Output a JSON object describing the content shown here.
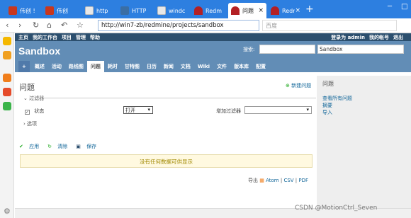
{
  "browser": {
    "tabs": [
      {
        "label": "伟创 !",
        "color": "#c8371e"
      },
      {
        "label": "伟创",
        "color": "#c8371e"
      },
      {
        "label": "http",
        "color": "#e8e8e8"
      },
      {
        "label": "HTTP",
        "color": "#3a6ea5"
      },
      {
        "label": "windc",
        "color": "#e8e8e8"
      },
      {
        "label": "Redm",
        "color": "#b32024"
      },
      {
        "label": "问题",
        "color": "#b32024"
      },
      {
        "label": "Redm",
        "color": "#b32024"
      }
    ],
    "new_tab": "+",
    "url": "http://win7-zb/redmine/projects/sandbox",
    "search_placeholder": "百度"
  },
  "redmine": {
    "top_menu": [
      "主页",
      "我的工作台",
      "项目",
      "管理",
      "帮助"
    ],
    "logged_in_as": "登录为 admin",
    "my_account": "我的帐号",
    "logout": "退出",
    "project_title": "Sandbox",
    "search_label": "搜索:",
    "project_jump": "Sandbox",
    "main_menu": [
      "+",
      "概述",
      "活动",
      "路线图",
      "问题",
      "耗时",
      "甘特图",
      "日历",
      "新闻",
      "文档",
      "Wiki",
      "文件",
      "版本库",
      "配置"
    ],
    "active_menu": "问题"
  },
  "content": {
    "title": "问题",
    "new_issue": "新建问题",
    "filters_label": "过滤器",
    "status_label": "状态",
    "status_operator": "打开",
    "add_filter_label": "增加过滤器",
    "options_label": "选项",
    "apply": "应用",
    "clear": "清除",
    "save": "保存",
    "no_data": "没有任何数据可供显示",
    "export_label": "导出",
    "export_atom": "Atom",
    "export_csv": "CSV",
    "export_pdf": "PDF"
  },
  "sidebar_right": {
    "title": "问题",
    "links": [
      "查看所有问题",
      "摘要",
      "导入"
    ]
  },
  "watermark": "CSDN @MotionCtrl_Seven"
}
